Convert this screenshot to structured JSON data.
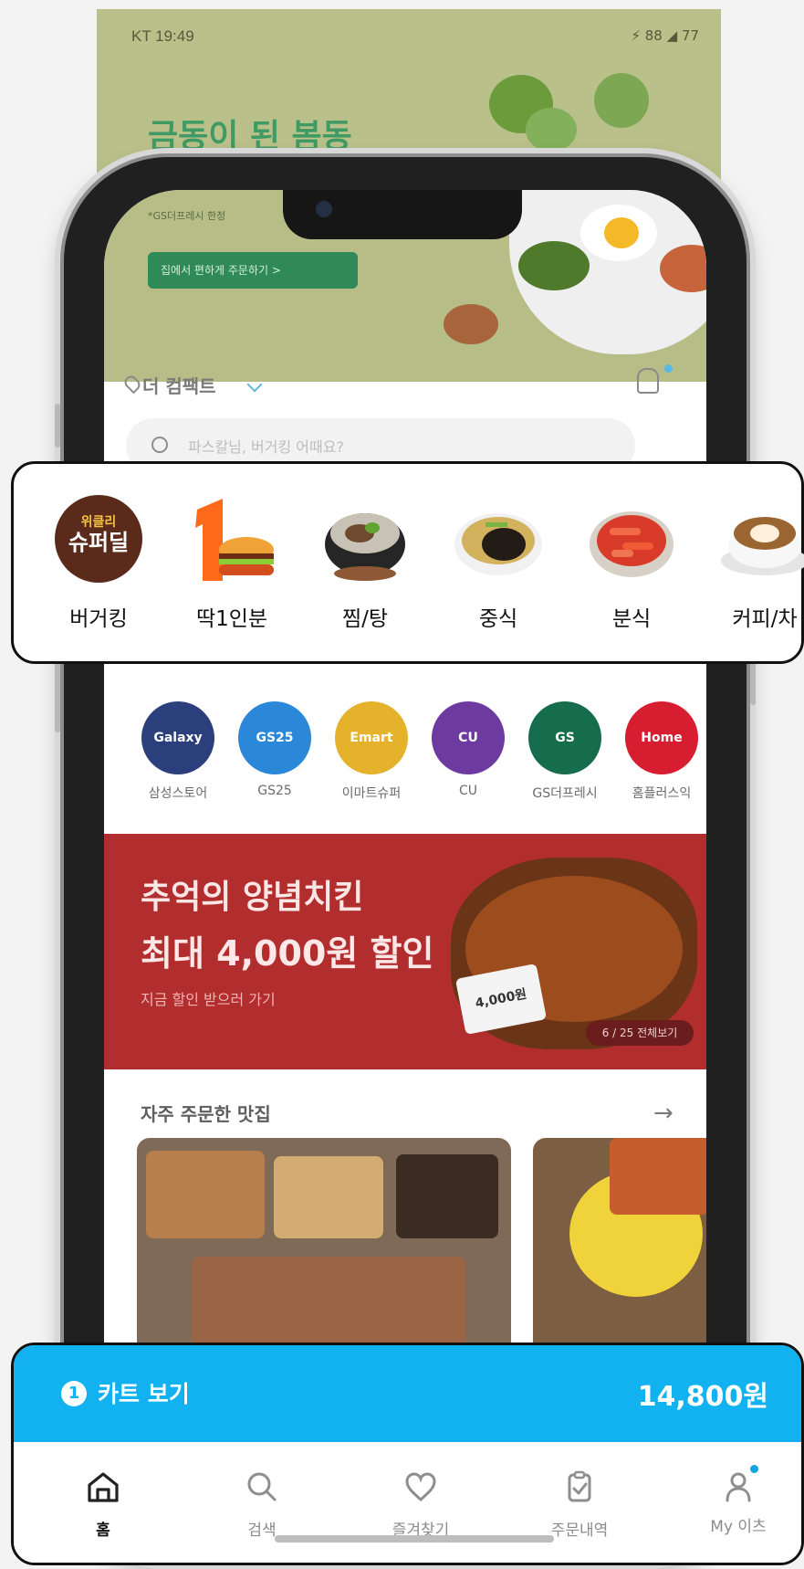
{
  "background_bleed": {
    "status_left": "KT 19:49",
    "status_right": "⚡ 88 ◢ 77",
    "hero_title": "금동이 된 봄동"
  },
  "screen_top": {
    "subtext": "*GS더프레시 한정",
    "promo_button": "집에서 편하게 주문하기 >"
  },
  "location": {
    "name": "더 컴팩트"
  },
  "search": {
    "placeholder": "파스칼님, 버거킹 어때요?"
  },
  "categories": [
    {
      "label": "버거킹",
      "icon": "weekly-super-deal-badge"
    },
    {
      "label": "딱1인분",
      "icon": "single-serving-burger"
    },
    {
      "label": "찜/탕",
      "icon": "stew-bowl"
    },
    {
      "label": "중식",
      "icon": "jajangmyeon-bowl"
    },
    {
      "label": "분식",
      "icon": "tteokbokki-plate"
    },
    {
      "label": "커피/차",
      "icon": "latte-cup"
    }
  ],
  "brand_stores": [
    {
      "label": "삼성스토어",
      "color": "#2b3f7c",
      "text": "Galaxy"
    },
    {
      "label": "GS25",
      "color": "#2b88d8",
      "text": "GS25"
    },
    {
      "label": "이마트슈퍼",
      "color": "#e4b32b",
      "text": "Emart"
    },
    {
      "label": "CU",
      "color": "#6d3b9f",
      "text": "CU"
    },
    {
      "label": "GS더프레시",
      "color": "#166d4d",
      "text": "GS"
    },
    {
      "label": "홈플러스익",
      "color": "#d71e31",
      "text": "Home"
    }
  ],
  "banner": {
    "line1": "추억의 양념치킨",
    "line2": "최대 4,000원 할인",
    "cta": "지금 할인 받으러 가기",
    "tag": "4,000원",
    "counter": "6 / 25 전체보기"
  },
  "section": {
    "title": "자주 주문한 맛집",
    "arrow": "→"
  },
  "cart": {
    "count": "1",
    "label": "카트 보기",
    "price": "14,800원"
  },
  "tabs": [
    {
      "label": "홈",
      "icon": "home-icon",
      "active": true
    },
    {
      "label": "검색",
      "icon": "search-icon",
      "active": false
    },
    {
      "label": "즐겨찾기",
      "icon": "heart-icon",
      "active": false
    },
    {
      "label": "주문내역",
      "icon": "clipboard-check-icon",
      "active": false
    },
    {
      "label": "My 이츠",
      "icon": "profile-icon",
      "active": false
    }
  ]
}
